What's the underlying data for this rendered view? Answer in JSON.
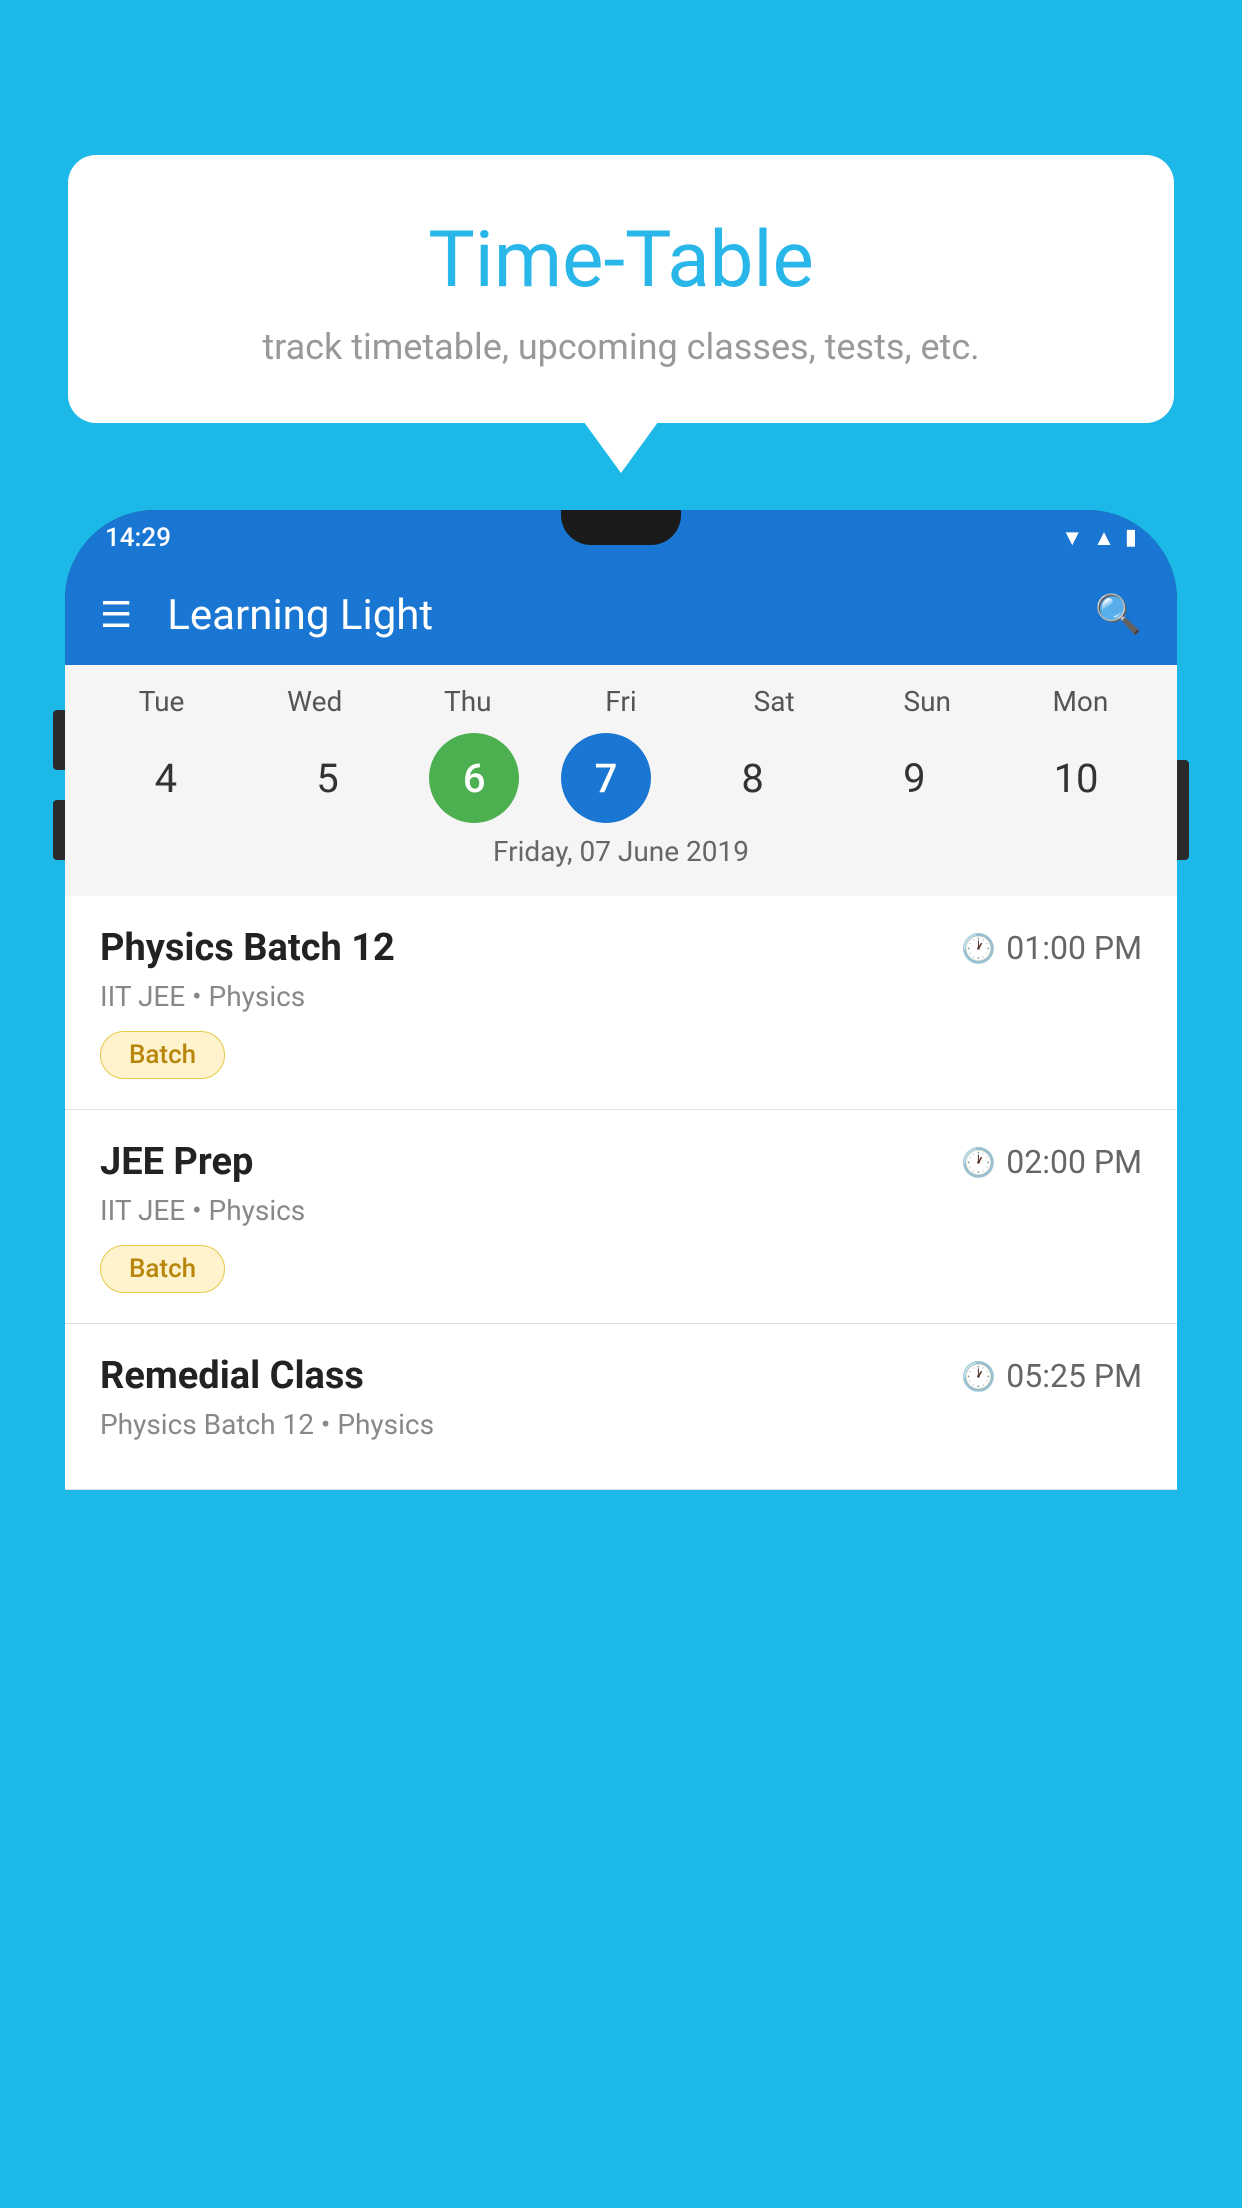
{
  "background_color": "#1cb8e8",
  "speech_bubble": {
    "title": "Time-Table",
    "subtitle": "track timetable, upcoming classes, tests, etc."
  },
  "app": {
    "status_bar": {
      "time": "14:29"
    },
    "app_bar": {
      "title": "Learning Light"
    },
    "calendar": {
      "day_headers": [
        "Tue",
        "Wed",
        "Thu",
        "Fri",
        "Sat",
        "Sun",
        "Mon"
      ],
      "day_numbers": [
        {
          "number": "4",
          "state": "normal"
        },
        {
          "number": "5",
          "state": "normal"
        },
        {
          "number": "6",
          "state": "today"
        },
        {
          "number": "7",
          "state": "selected"
        },
        {
          "number": "8",
          "state": "normal"
        },
        {
          "number": "9",
          "state": "normal"
        },
        {
          "number": "10",
          "state": "normal"
        }
      ],
      "selected_date_label": "Friday, 07 June 2019"
    },
    "classes": [
      {
        "name": "Physics Batch 12",
        "time": "01:00 PM",
        "meta": "IIT JEE • Physics",
        "badge": "Batch"
      },
      {
        "name": "JEE Prep",
        "time": "02:00 PM",
        "meta": "IIT JEE • Physics",
        "badge": "Batch"
      },
      {
        "name": "Remedial Class",
        "time": "05:25 PM",
        "meta": "Physics Batch 12 • Physics",
        "badge": null
      }
    ]
  },
  "icons": {
    "menu": "☰",
    "search": "🔍",
    "clock": "🕐"
  }
}
